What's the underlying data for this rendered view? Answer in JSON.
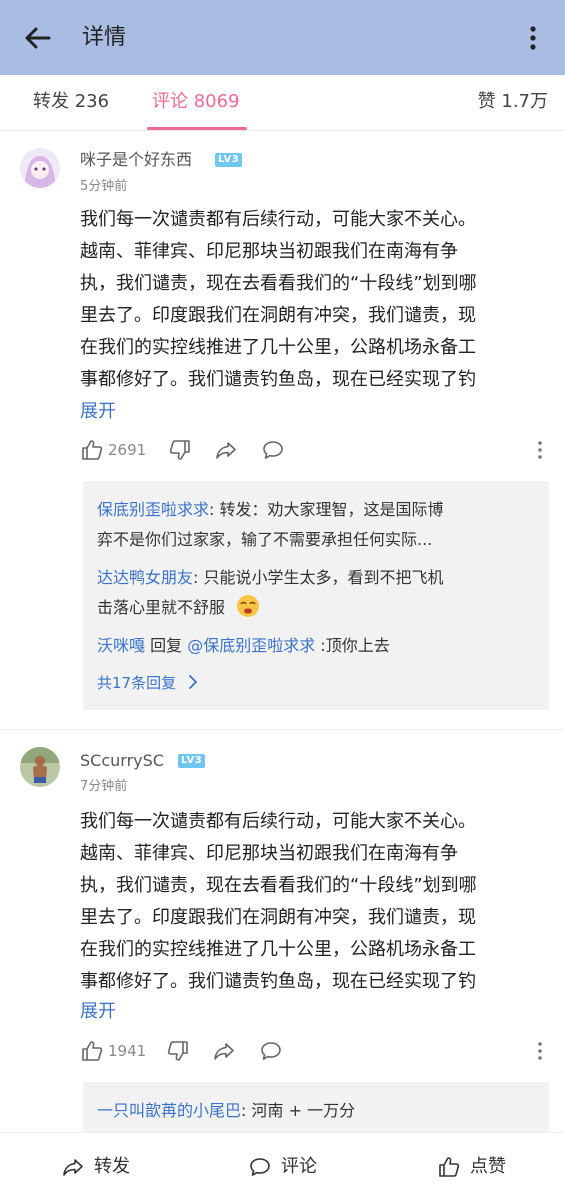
{
  "header": {
    "title": "详情"
  },
  "tabs": {
    "repost": "转发 236",
    "comments": "评论 8069",
    "likes": "赞 1.7万"
  },
  "comments": [
    {
      "username": "咪子是个好东西",
      "level": "LV3",
      "time": "5分钟前",
      "lines": [
        "我们每一次谴责都有后续行动，可能大家不关心。",
        "越南、菲律宾、印尼那块当初跟我们在南海有争",
        "执，我们谴责，现在去看看我们的“十段线”划到哪",
        "里去了。印度跟我们在洞朗有冲突，我们谴责，现",
        "在我们的实控线推进了几十公里，公路机场永备工",
        "事都修好了。我们谴责钓鱼岛，现在已经实现了钓"
      ],
      "expand": "展开",
      "likes": "2691",
      "replies": [
        {
          "name": "保底别歪啦求求",
          "sep": ": ",
          "text": "转发：劝大家理智，这是国际博",
          "text2": "弈不是你们过家家，输了不需要承担任何实际..."
        },
        {
          "name": "达达鸭女朋友",
          "sep": ": ",
          "text": "只能说小学生太多，看到不把飞机",
          "text2": "击落心里就不舒服"
        },
        {
          "name": "沃咪嘎",
          "mid": " 回复 ",
          "target": "@保底别歪啦求求",
          "text": " :顶你上去"
        }
      ],
      "replies_more": "共17条回复"
    },
    {
      "username": "SCcurrySC",
      "level": "LV3",
      "time": "7分钟前",
      "lines": [
        "我们每一次谴责都有后续行动，可能大家不关心。",
        "越南、菲律宾、印尼那块当初跟我们在南海有争",
        "执，我们谴责，现在去看看我们的“十段线”划到哪",
        "里去了。印度跟我们在洞朗有冲突，我们谴责，现",
        "在我们的实控线推进了几十公里，公路机场永备工",
        "事都修好了。我们谴责钓鱼岛，现在已经实现了钓"
      ],
      "expand": "展开",
      "likes": "1941",
      "replies": [
        {
          "name": "一只叫歆苒的小尾巴",
          "sep": ": ",
          "text": "河南 + 一万分"
        }
      ]
    }
  ],
  "bottom": {
    "repost": "转发",
    "comment": "评论",
    "like": "点赞"
  },
  "colors": {
    "header_bg": "#a9bde2",
    "accent_pink": "#ee6a93",
    "link_blue": "#3b73c8",
    "level_badge": "#6fc7f0"
  }
}
